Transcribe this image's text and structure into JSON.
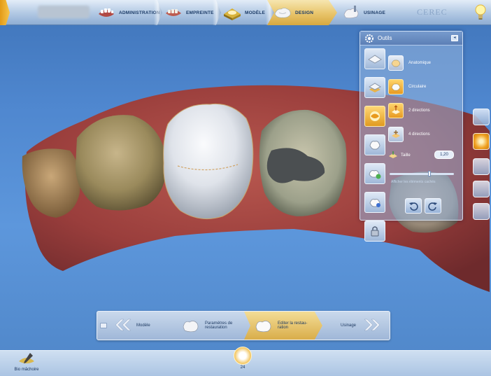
{
  "topbar": {
    "patient_name": "",
    "stages": [
      {
        "label": "ADMINISTRATION",
        "icon": "jaw-admin-icon"
      },
      {
        "label": "EMPREINTE",
        "icon": "jaw-scan-icon"
      },
      {
        "label": "MODÈLE",
        "icon": "model-icon"
      },
      {
        "label": "DESIGN",
        "icon": "design-icon",
        "active": true
      },
      {
        "label": "USINAGE",
        "icon": "milling-icon"
      }
    ],
    "brand": "CEREC",
    "help_icon": "lightbulb-icon"
  },
  "tools": {
    "title": "Outils",
    "close_glyph": "◂",
    "options": [
      {
        "label": "Anatomique",
        "active": false
      },
      {
        "label": "Circulaire",
        "active": true
      },
      {
        "label": "2 directions",
        "active": true
      },
      {
        "label": "4 directions",
        "active": false
      }
    ],
    "size_label": "Taille",
    "size_value": "1,20",
    "slider_position": 0.62,
    "hide_label": "Afficher les éléments cachés",
    "undo_icon": "undo-icon",
    "redo_icon": "redo-icon"
  },
  "workflow": {
    "steps": [
      {
        "label": "Modèle"
      },
      {
        "label": "Paramètres de restauration"
      },
      {
        "label": "Editer la restau- ration",
        "active": true
      },
      {
        "label": "Usinage"
      }
    ]
  },
  "bottombar": {
    "jaw_label": "Bio mâchoire",
    "tooth_number": "24"
  },
  "colors": {
    "background": "#4f87cf",
    "active_accent": "#e8c46a",
    "gum": "#a84a45",
    "crown": "#d9dde3"
  }
}
